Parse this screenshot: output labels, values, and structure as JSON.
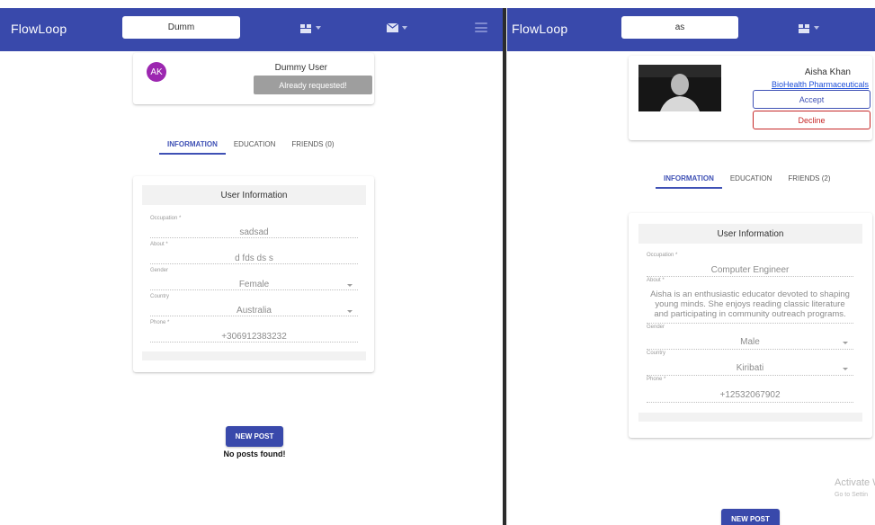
{
  "left": {
    "app": {
      "brand": "FlowLoop",
      "search_value": "Dumm",
      "icons": [
        "people-icon",
        "mail-icon",
        "menu-icon"
      ]
    },
    "profile": {
      "initials": "AK",
      "name": "Dummy User",
      "request_label": "Already requested!"
    },
    "tabs": [
      {
        "label": "INFORMATION",
        "active": true
      },
      {
        "label": "EDUCATION",
        "active": false
      },
      {
        "label": "FRIENDS (0)",
        "active": false
      }
    ],
    "info": {
      "title": "User Information",
      "fields": [
        {
          "label": "Occupation *",
          "value": "sadsad"
        },
        {
          "label": "About *",
          "value": "d fds ds s"
        },
        {
          "label": "Gender",
          "value": "Female"
        },
        {
          "label": "Country",
          "value": "Australia"
        },
        {
          "label": "Phone *",
          "value": "+306912383232"
        }
      ]
    },
    "posts": {
      "new_post_label": "NEW POST",
      "empty_text": "No posts found!"
    }
  },
  "right": {
    "app": {
      "brand": "FlowLoop",
      "search_value": "as",
      "icons": [
        "people-icon"
      ]
    },
    "profile": {
      "name": "Aisha Khan",
      "company": "BioHealth Pharmaceuticals",
      "accept_label": "Accept",
      "decline_label": "Decline"
    },
    "tabs": [
      {
        "label": "INFORMATION",
        "active": true
      },
      {
        "label": "EDUCATION",
        "active": false
      },
      {
        "label": "FRIENDS (2)",
        "active": false
      }
    ],
    "info": {
      "title": "User Information",
      "fields": [
        {
          "label": "Occupation *",
          "value": "Computer Engineer"
        },
        {
          "label": "About *",
          "value": "Aisha is an enthusiastic educator devoted to shaping young minds. She enjoys reading classic literature and participating in community outreach programs."
        },
        {
          "label": "Gender",
          "value": "Male"
        },
        {
          "label": "Country",
          "value": "Kiribati"
        },
        {
          "label": "Phone *",
          "value": "+12532067902"
        }
      ]
    },
    "posts": {
      "new_post_label": "NEW POST"
    },
    "watermark": {
      "line1": "Activate W",
      "line2": "Go to Settin"
    }
  },
  "colors": {
    "appbar": "#3949ab",
    "accent": "#3f51b5",
    "avatar": "#9c27b0",
    "decline": "#c62828",
    "requested": "#9e9e9e"
  }
}
